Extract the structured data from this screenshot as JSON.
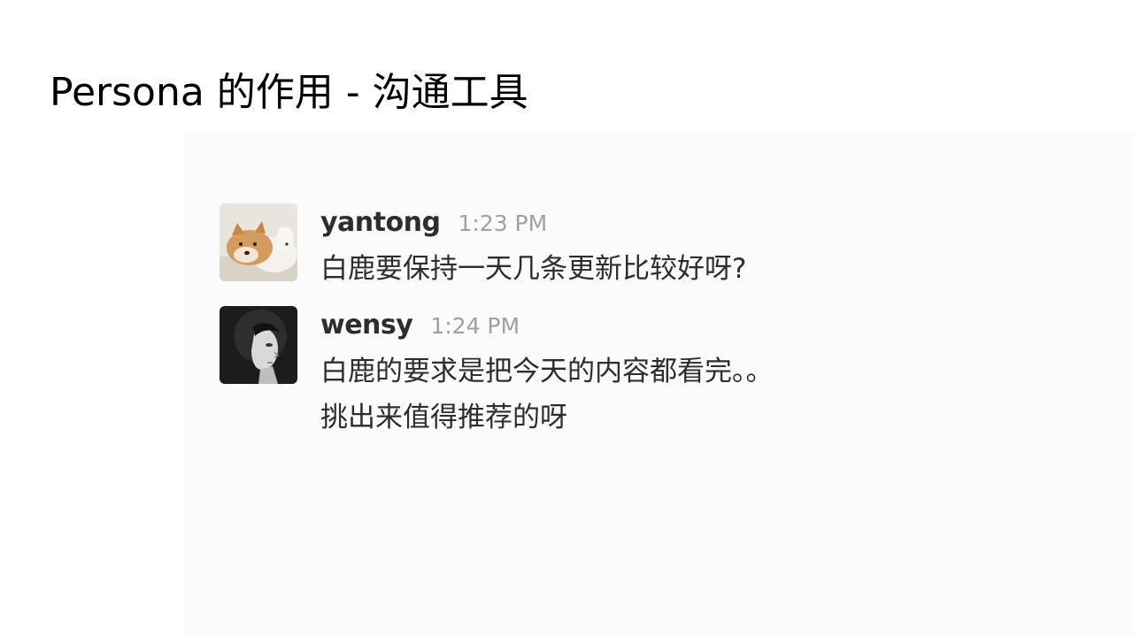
{
  "slide": {
    "title": "Persona 的作用 - 沟通工具"
  },
  "messages": [
    {
      "username": "yantong",
      "time": "1:23 PM",
      "avatar_icon": "dog-avatar-icon",
      "lines": [
        "白鹿要保持一天几条更新比较好呀?"
      ]
    },
    {
      "username": "wensy",
      "time": "1:24 PM",
      "avatar_icon": "woman-portrait-avatar-icon",
      "lines": [
        "白鹿的要求是把今天的内容都看完。。",
        "挑出来值得推荐的呀"
      ]
    }
  ],
  "colors": {
    "panel_background": "#fcfbfc",
    "username": "#2c2d30",
    "timestamp": "#a0a0a2",
    "text": "#2c2d30"
  }
}
